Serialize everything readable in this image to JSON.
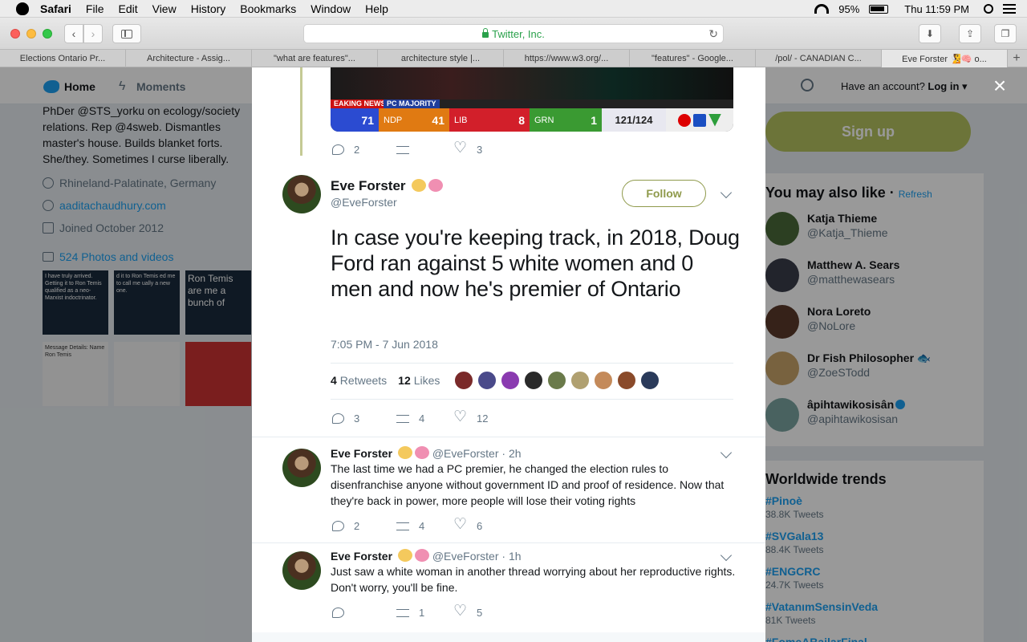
{
  "menubar": {
    "app": "Safari",
    "items": [
      "File",
      "Edit",
      "View",
      "History",
      "Bookmarks",
      "Window",
      "Help"
    ],
    "battery": "95%",
    "clock": "Thu 11:59 PM"
  },
  "browser": {
    "url_text": "Twitter, Inc.",
    "tabs": [
      {
        "title": "Elections Ontario Pr..."
      },
      {
        "title": "Architecture - Assig..."
      },
      {
        "title": "\"what are features\"..."
      },
      {
        "title": "architecture style |..."
      },
      {
        "title": "https://www.w3.org/..."
      },
      {
        "title": "\"features\" - Google..."
      },
      {
        "title": "/pol/ - CANADIAN C..."
      },
      {
        "title": "Eve Forster 🧏🧠 o..."
      }
    ],
    "new_tab": "+"
  },
  "twitter_nav": {
    "home": "Home",
    "moments": "Moments",
    "have_account": "Have an account?",
    "login": "Log in"
  },
  "profile": {
    "bio_lines": [
      "PhDer @STS_yorku on ecology/society",
      "relations. Rep @4sweb. Dismantles",
      "master's house. Builds blanket forts.",
      "She/they. Sometimes I curse liberally."
    ],
    "location": "Rhineland-Palatinate, Germany",
    "website": "aaditachaudhury.com",
    "joined": "Joined October 2012",
    "photos": "524 Photos and videos",
    "thumb_texts": [
      "I have truly arrived. Getting it to Ron Temis qualified as a neo-Marxist indoctrinator.",
      "d it to Ron Temis ed me to call me ually a new one.",
      "Ron Temis are me a bunch of",
      "Message Details: Name Ron Temis"
    ]
  },
  "sidebar": {
    "signup": "Sign up",
    "wtf_title": "You may also like",
    "refresh": "Refresh",
    "people": [
      {
        "name": "Katja Thieme",
        "handle": "@Katja_Thieme"
      },
      {
        "name": "Matthew A. Sears",
        "handle": "@matthewasears"
      },
      {
        "name": "Nora Loreto",
        "handle": "@NoLore"
      },
      {
        "name": "Dr Fish Philosopher 🐟",
        "handle": "@ZoeSTodd"
      },
      {
        "name": "âpihtawikosisân",
        "handle": "@apihtawikosisan"
      }
    ],
    "trends_title": "Worldwide trends",
    "trends": [
      {
        "tag": "#Pinoè",
        "count": "38.8K Tweets"
      },
      {
        "tag": "#SVGala13",
        "count": "88.4K Tweets"
      },
      {
        "tag": "#ENGCRC",
        "count": "24.7K Tweets"
      },
      {
        "tag": "#VatanımSensinVeda",
        "count": "81K Tweets"
      },
      {
        "tag": "#FomeABailarFinal",
        "count": ""
      }
    ]
  },
  "previous_tweet": {
    "media": {
      "breaking": "EAKING NEWS",
      "pc_majority": "PC MAJORITY",
      "pc": "71",
      "ndp_label": "NDP",
      "ndp": "41",
      "lib_label": "LIB",
      "lib": "8",
      "grn_label": "GRN",
      "grn": "1",
      "count": "121/124"
    },
    "replies": "2",
    "retweets": "",
    "likes": "3"
  },
  "main_tweet": {
    "name": "Eve Forster",
    "handle": "@EveForster",
    "follow": "Follow",
    "text": "In case you're keeping track, in 2018, Doug Ford ran against 5 white women and 0 men and now he's premier of Ontario",
    "timestamp": "7:05 PM - 7 Jun 2018",
    "retweets_count": "4",
    "retweets_label": "Retweets",
    "likes_count": "12",
    "likes_label": "Likes",
    "replies": "3",
    "retweets": "4",
    "likes": "12"
  },
  "replies": [
    {
      "name": "Eve Forster",
      "meta": "@EveForster · 2h",
      "text": "The last time we had a PC premier, he changed the election rules to disenfranchise anyone without government ID and proof of residence. Now that they're back in power, more people will lose their voting rights",
      "replies": "2",
      "retweets": "4",
      "likes": "6"
    },
    {
      "name": "Eve Forster",
      "meta": "@EveForster · 1h",
      "text": "Just saw a white woman in another thread worrying about her reproductive rights. Don't worry, you'll be fine.",
      "replies": "",
      "retweets": "1",
      "likes": "5"
    }
  ],
  "close": "×"
}
